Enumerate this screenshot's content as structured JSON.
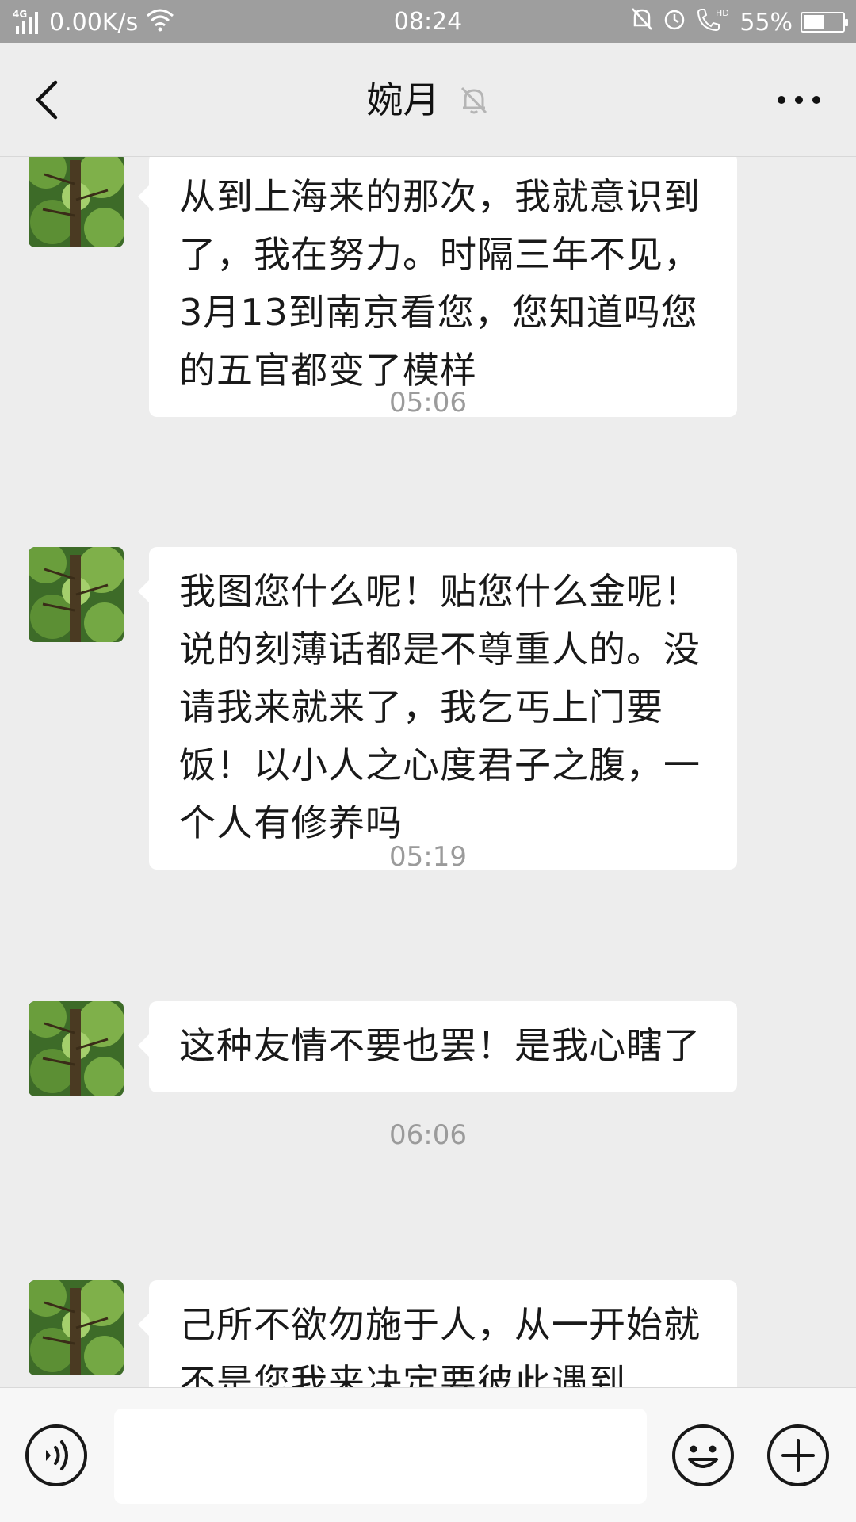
{
  "status_bar": {
    "network": "4G",
    "speed": "0.00K/s",
    "time": "08:24",
    "battery_percent": "55%",
    "battery_level": 0.55
  },
  "header": {
    "title": "婉月",
    "back_icon": "chevron-left-icon",
    "mute_icon": "bell-muted-icon",
    "more_icon": "more-dots-icon"
  },
  "messages": [
    {
      "type": "text",
      "text": "从到上海来的那次，我就意识到了，我在努力。时隔三年不见，3月13到南京看您，您知道吗您的五官都变了模样"
    },
    {
      "type": "time",
      "text": "05:06"
    },
    {
      "type": "text",
      "text": "我图您什么呢！贴您什么金呢！说的刻薄话都是不尊重人的。没请我来就来了，我乞丐上门要饭！以小人之心度君子之腹，一个人有修养吗"
    },
    {
      "type": "time",
      "text": "05:19"
    },
    {
      "type": "text",
      "text": "这种友情不要也罢！是我心瞎了"
    },
    {
      "type": "time",
      "text": "06:06"
    },
    {
      "type": "text",
      "text": "己所不欲勿施于人，从一开始就不是您我来决定要彼此遇到"
    }
  ],
  "input_bar": {
    "voice_icon": "voice-icon",
    "text_value": "",
    "emoji_icon": "emoji-icon",
    "plus_icon": "plus-icon"
  },
  "colors": {
    "background": "#ededed",
    "bubble": "#ffffff",
    "status_bar": "#9e9e9e",
    "time_text": "#9b9b9b"
  }
}
